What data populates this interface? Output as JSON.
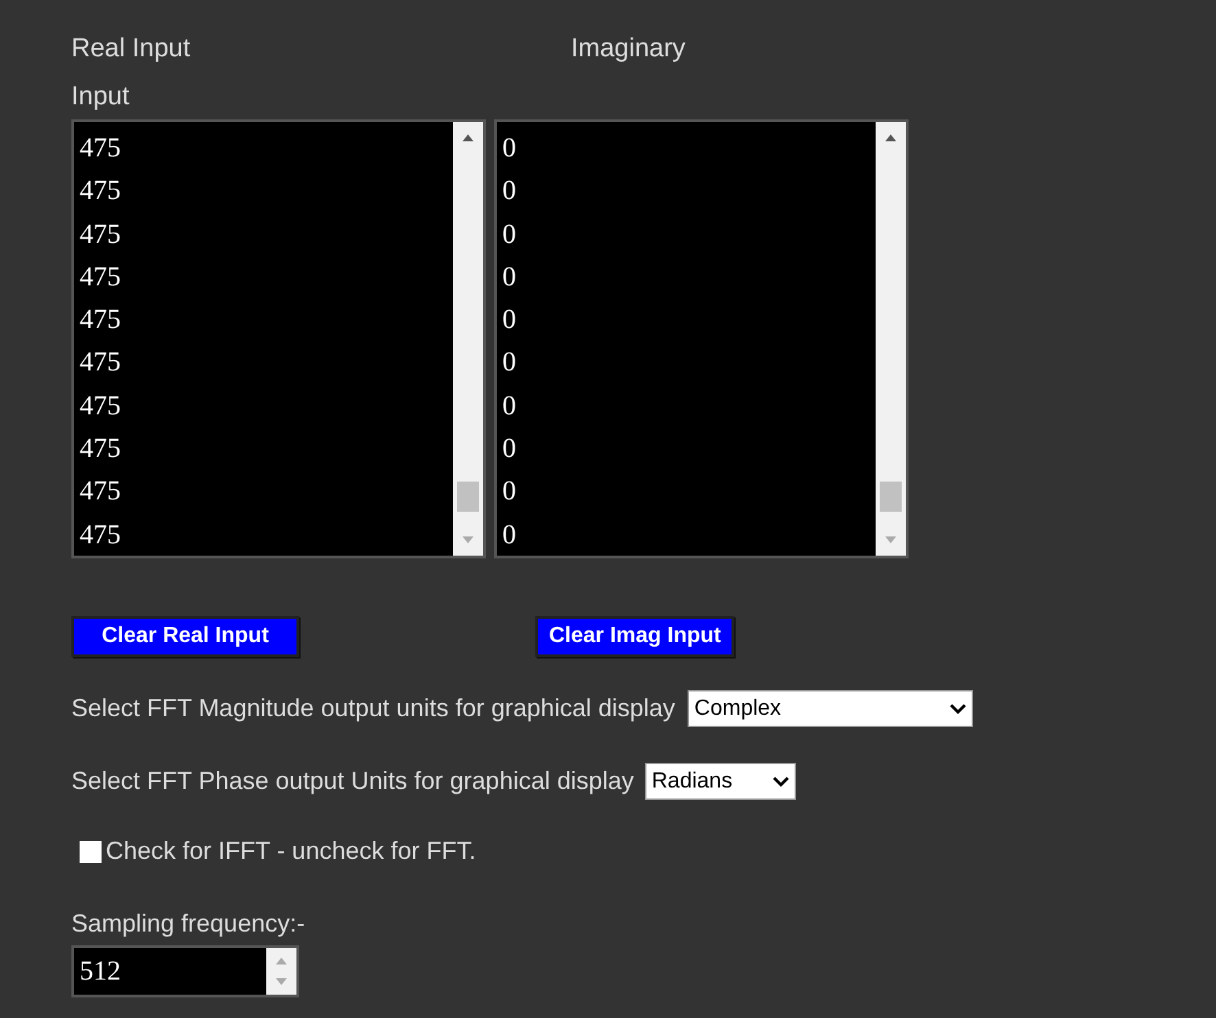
{
  "labels": {
    "real": "Real Input",
    "imaginary": "Imaginary",
    "input": "Input"
  },
  "real_input": {
    "value": [
      "475",
      "475",
      "475",
      "475",
      "475",
      "475",
      "475",
      "475",
      "475",
      "475"
    ]
  },
  "imag_input": {
    "value": [
      "0",
      "0",
      "0",
      "0",
      "0",
      "0",
      "0",
      "0",
      "0",
      "0"
    ]
  },
  "buttons": [
    "Clear Real Input",
    "Clear Imag Input"
  ],
  "magnitude": {
    "label": "Select FFT Magnitude output units for graphical display",
    "value": "Complex"
  },
  "phase": {
    "label": "Select FFT Phase output Units for graphical display",
    "value": "Radians"
  },
  "ifft": {
    "label": "Check for IFFT - uncheck for FFT.",
    "checked": false
  },
  "sampling": {
    "label": "Sampling frequency:-",
    "value": "512"
  }
}
